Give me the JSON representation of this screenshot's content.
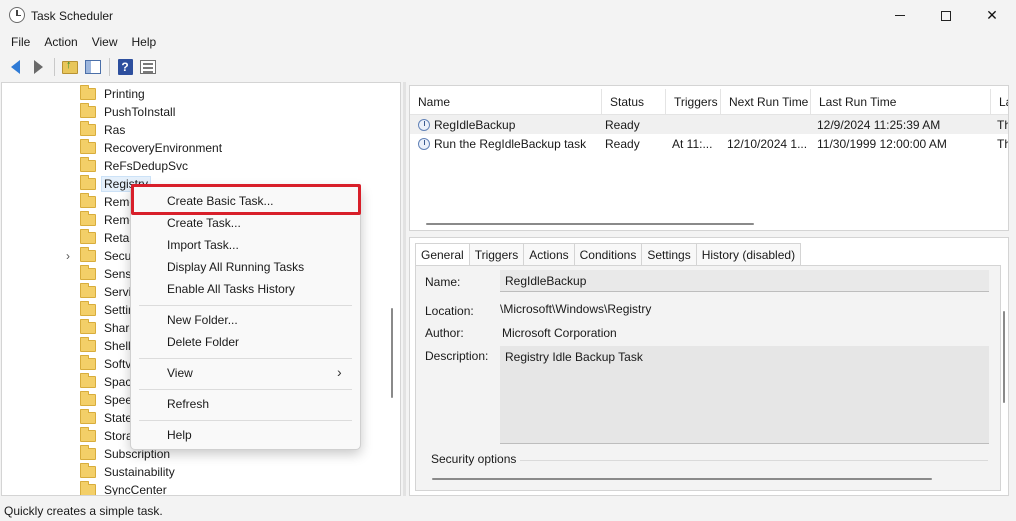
{
  "window": {
    "title": "Task Scheduler"
  },
  "menubar": [
    "File",
    "Action",
    "View",
    "Help"
  ],
  "toolbar": {
    "back_icon": "back-arrow-icon",
    "forward_icon": "forward-arrow-icon",
    "up_icon": "folder-up-icon",
    "panel_icon": "show-hide-pane-icon",
    "help_icon": "help-icon",
    "help_glyph": "?",
    "props_icon": "properties-icon"
  },
  "tree": {
    "items": [
      "Printing",
      "PushToInstall",
      "Ras",
      "RecoveryEnvironment",
      "ReFsDedupSvc",
      "Registry",
      "Remo",
      "Remo",
      "Retai",
      "Secu",
      "Sensi",
      "Servi",
      "Settin",
      "Share",
      "Shell",
      "Softv",
      "Spac",
      "Spee",
      "State",
      "Stora",
      "Subscription",
      "Sustainability",
      "SyncCenter"
    ],
    "selected": "Registry",
    "expander_glyph": "›"
  },
  "task_list": {
    "columns": [
      "Name",
      "Status",
      "Triggers",
      "Next Run Time",
      "Last Run Time",
      "La"
    ],
    "rows": [
      {
        "name": "RegIdleBackup",
        "status": "Ready",
        "triggers": "",
        "next_run": "",
        "last_run": "12/9/2024 11:25:39 AM",
        "last_result": "Th"
      },
      {
        "name": "Run the RegIdleBackup task",
        "status": "Ready",
        "triggers": "At 11:...",
        "next_run": "12/10/2024 1...",
        "last_run": "11/30/1999 12:00:00 AM",
        "last_result": "Th"
      }
    ]
  },
  "details": {
    "tabs": [
      "General",
      "Triggers",
      "Actions",
      "Conditions",
      "Settings",
      "History (disabled)"
    ],
    "active_tab": "General",
    "name_label": "Name:",
    "name_value": "RegIdleBackup",
    "location_label": "Location:",
    "location_value": "\\Microsoft\\Windows\\Registry",
    "author_label": "Author:",
    "author_value": "Microsoft Corporation",
    "description_label": "Description:",
    "description_value": "Registry Idle Backup Task",
    "security_label": "Security options"
  },
  "context_menu": {
    "items": [
      "Create Basic Task...",
      "Create Task...",
      "Import Task...",
      "Display All Running Tasks",
      "Enable All Tasks History",
      "New Folder...",
      "Delete Folder",
      "View",
      "Refresh",
      "Help"
    ],
    "submenu_glyph": "›",
    "highlight_color": "#d81f2a"
  },
  "statusbar": {
    "text": "Quickly creates a simple task."
  }
}
